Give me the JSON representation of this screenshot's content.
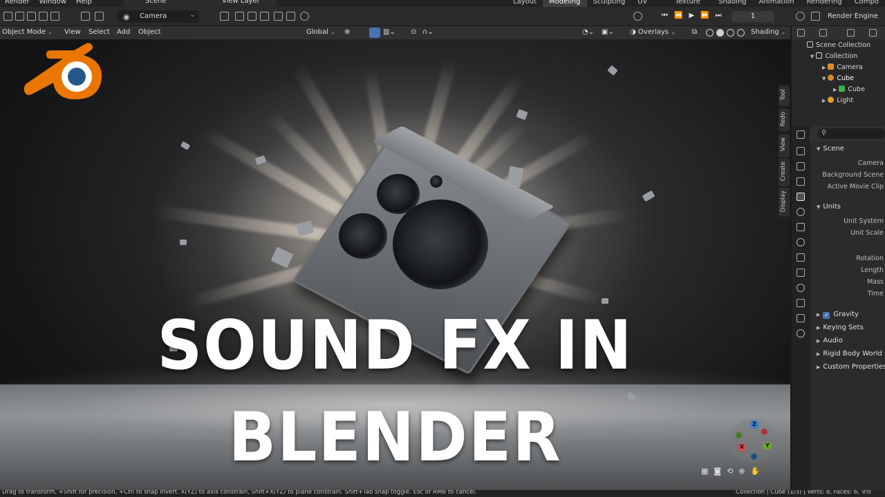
{
  "top_menu": [
    "Render",
    "Window",
    "Help"
  ],
  "scene_selector": "Scene",
  "view_layer_selector": "View Layer",
  "workspaces": [
    "Layout",
    "Modeling",
    "Sculpting",
    "UV Editing",
    "Texture Paint",
    "Shading",
    "Animation",
    "Rendering",
    "Compo"
  ],
  "active_workspace": "Modeling",
  "camera_selector": "Camera",
  "frame_current": "1",
  "render_engine_label": "Render Engine",
  "viewport_header": {
    "mode": "Object Mode",
    "menus": [
      "View",
      "Select",
      "Add",
      "Object"
    ],
    "transform_orientation": "Global",
    "overlays": "Overlays",
    "shading": "Shading"
  },
  "thumbnail_title": {
    "line1": "SOUND FX IN",
    "line2": "BLENDER"
  },
  "side_tabs": [
    "Tool",
    "Redo",
    "View",
    "Create",
    "Display"
  ],
  "outliner": {
    "scene_collection": "Scene Collection",
    "collection": "Collection",
    "items": [
      "Camera",
      "Cube",
      "Cube",
      "Light"
    ]
  },
  "properties": {
    "search_placeholder": "",
    "scene_section": "Scene",
    "scene_fields": [
      "Camera",
      "Background Scene",
      "Active Movie Clip"
    ],
    "units_section": "Units",
    "units_fields": [
      "Unit System",
      "Unit Scale"
    ],
    "units_fields2": [
      "Rotation",
      "Length",
      "Mass",
      "Time"
    ],
    "gravity": "Gravity",
    "gravity_checked": true,
    "collapsed_sections": [
      "Keying Sets",
      "Audio",
      "Rigid Body World",
      "Custom Properties"
    ]
  },
  "gizmo_axes": [
    "Z",
    "Y",
    "X"
  ],
  "status_bar": {
    "hint": "Drag to transform, +Shift for precision, +Ctrl to snap invert. X(YZ) to axis constrain, Shift+X(YZ) to plane constrain. Shift+Tab snap toggle. Esc or RMB to cancel.",
    "stats": "Collection | Cube (1/3) | Verts: 8, Faces: 6, Tris"
  },
  "colors": {
    "accent_blue": "#4772b3",
    "blender_orange": "#ea7600",
    "blender_blue": "#265787"
  }
}
